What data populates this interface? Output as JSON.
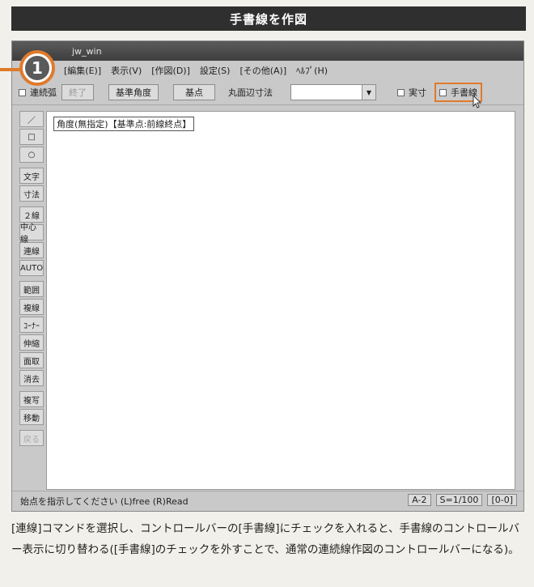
{
  "banner": {
    "title": "手書線を作図"
  },
  "window": {
    "title": "jw_win",
    "menu": [
      "[編集(E)]",
      "表示(V)",
      "[作図(D)]",
      "設定(S)",
      "[その他(A)]",
      "ﾍﾙﾌﾟ(H)"
    ],
    "step_number": "1"
  },
  "controlbar": {
    "continuous_arc": "連続弧",
    "end_button": "終了",
    "base_angle_button": "基準角度",
    "base_point_button": "基点",
    "round_dim_label": "丸面辺寸法",
    "round_dim_value": "",
    "actual_size": "実寸",
    "handwritten_line": "手書線"
  },
  "toolbar": {
    "items": [
      "／",
      "□",
      "○",
      "文字",
      "寸法",
      "２線",
      "中心線",
      "連線",
      "AUTO",
      "範囲",
      "複線",
      "ｺｰﾅｰ",
      "伸縮",
      "面取",
      "消去",
      "複写",
      "移動",
      "戻る"
    ]
  },
  "canvas": {
    "prompt": "角度(無指定)【基準点:前線終点】"
  },
  "statusbar": {
    "message": "始点を指示してください (L)free (R)Read",
    "paper": "A-2",
    "scale": "S=1/100",
    "layer": "[0-0]"
  },
  "caption": {
    "text": "[連線]コマンドを選択し、コントロールバーの[手書線]にチェックを入れると、手書線のコントロールバー表示に切り替わる([手書線]のチェックを外すことで、通常の連続線作図のコントロールバーになる)。"
  },
  "colors": {
    "accent": "#e07a2c",
    "banner_bg": "#2f2f2f"
  }
}
